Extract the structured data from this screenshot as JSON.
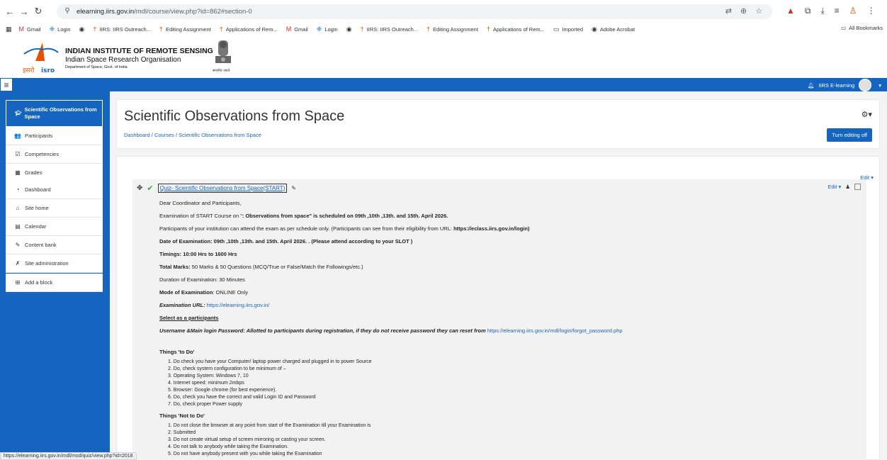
{
  "browser": {
    "url_host": "elearning.iirs.gov.in",
    "url_path": "/mdl/course/view.php?id=862#section-0",
    "bookmarks": [
      {
        "label": "Gmail",
        "icon": "gmail-icon",
        "glyph": "M",
        "color": "#d93025"
      },
      {
        "label": "Login",
        "icon": "login-icon",
        "glyph": "❈",
        "color": "#1565c0"
      },
      {
        "label": "",
        "icon": "globe-icon",
        "glyph": "◉",
        "color": "#333"
      },
      {
        "label": "IIRS: IIRS Outreach...",
        "icon": "iirs-icon",
        "glyph": "†",
        "color": "#e65100"
      },
      {
        "label": "Editing Assignment",
        "icon": "iirs-icon",
        "glyph": "†",
        "color": "#e65100"
      },
      {
        "label": "Applications of Rem...",
        "icon": "iirs-icon",
        "glyph": "†",
        "color": "#e65100"
      },
      {
        "label": "Gmail",
        "icon": "gmail-icon",
        "glyph": "M",
        "color": "#d93025"
      },
      {
        "label": "Login",
        "icon": "login-icon",
        "glyph": "❈",
        "color": "#1565c0"
      },
      {
        "label": "",
        "icon": "globe-icon",
        "glyph": "◉",
        "color": "#333"
      },
      {
        "label": "IIRS: IIRS Outreach...",
        "icon": "iirs-icon",
        "glyph": "†",
        "color": "#e65100"
      },
      {
        "label": "Editing Assignment",
        "icon": "iirs-icon",
        "glyph": "†",
        "color": "#e65100"
      },
      {
        "label": "Applications of Rem...",
        "icon": "iirs-icon",
        "glyph": "†",
        "color": "#e65100"
      },
      {
        "label": "Imported",
        "icon": "folder-icon",
        "glyph": "▭",
        "color": "#333"
      },
      {
        "label": "Adobe Acrobat",
        "icon": "globe-icon",
        "glyph": "◉",
        "color": "#333"
      }
    ],
    "all_bookmarks": "All Bookmarks",
    "status_url": "https://elearning.iirs.gov.in/mdl/mod/quiz/view.php?id=2018"
  },
  "header": {
    "inst_en": "INDIAN INSTITUTE OF REMOTE SENSING",
    "org": "Indian Space Research Organisation",
    "dept": "Department of Space, Govt. of India",
    "logo_text": "इसरो isro",
    "emblem_text": "सत्यमेव जयते"
  },
  "navbar": {
    "site_name": "IIRS E-learning",
    "accent": "#1565c0"
  },
  "drawer": {
    "course": "Scientific Observations from Space",
    "items1": [
      {
        "label": "Participants",
        "icon": "users-icon",
        "glyph": "👥"
      },
      {
        "label": "Competencies",
        "icon": "check-square-icon",
        "glyph": "☑"
      },
      {
        "label": "Grades",
        "icon": "table-icon",
        "glyph": "▦"
      }
    ],
    "items2": [
      {
        "label": "Dashboard",
        "icon": "dashboard-icon",
        "glyph": "◔"
      },
      {
        "label": "Site home",
        "icon": "home-icon",
        "glyph": "⌂"
      },
      {
        "label": "Calendar",
        "icon": "calendar-icon",
        "glyph": "▤"
      },
      {
        "label": "Content bank",
        "icon": "paint-brush-icon",
        "glyph": "✎"
      }
    ],
    "items3": [
      {
        "label": "Site administration",
        "icon": "wrench-icon",
        "glyph": "✗"
      }
    ],
    "items4": [
      {
        "label": "Add a block",
        "icon": "plus-square-icon",
        "glyph": "⊞"
      }
    ]
  },
  "page": {
    "title": "Scientific Observations from Space",
    "breadcrumb": [
      "Dashboard",
      "Courses",
      "Scientific Observations from Space"
    ],
    "turn_editing": "Turn editing off",
    "edit_label": "Edit ▾"
  },
  "activity": {
    "quiz_title": "Quiz- Scientific Observations from Space(START)"
  },
  "content": {
    "greeting": "Dear Coordinator and Participants,",
    "exam_line_a": "Examination of  START Course on \"",
    "exam_line_b": ": Observations from space\" is scheduled on  09",
    "exam_line_dates": "th ,10th ,13th. and 15th. April 2026.",
    "participants_line_a": "Participants of your institution can attend the exam as per schedule only. (Participants can see from their eligibility from URL:  ",
    "participants_url": "https://eclass.iirs.gov.in/login)",
    "date_line": "Date of Examination:  09th ,10th ,13th. and 15th. April 2026. . (Please attend according to your SLOT )",
    "timings": "Timings:  10:00 Hrs to 1600 Hrs",
    "total_marks_label": "Total Marks:",
    "total_marks_value": " 50 Marks & 50 Questions (MCQ/True or False/Match the Followings/etc.)",
    "duration": "Duration of Examination: 30 Minutes",
    "mode_label": "Mode of Examination",
    "mode_value": ": ONLINE Only",
    "exam_url_label": "Examination URL: ",
    "exam_url": "https://elearning.iirs.gov.in/",
    "select_participants": "Select as a participants",
    "username_line": "Username &Main login Password:  Allotted to participants during registration, if they do not receive password they can reset from ",
    "reset_url": "https://elearning.iirs.gov.in/mdl/login/forgot_password.php",
    "todo_title": "Things 'to Do'",
    "todo": [
      "1. Do check you have your Computer/ laptop power charged and plugged in to power Source",
      "2. Do, check system configuration to be minimum of –",
      "3. Operating System: Windows 7, 10",
      "4. Internet speed: minimum 2mbps",
      "5. Browser: Google chrome (for best experience).",
      "6. Do, check you have the correct and valid Login ID and Password",
      "7. Do, check proper Power supply"
    ],
    "nottodo_title": "Things 'Not to Do'",
    "nottodo": [
      "1. Do not close the browser at any point from start of the Examination till your Examination is",
      "2. Submitted",
      "3. Do not create virtual setup of screen mirroring or casting your screen.",
      "4. Do not talk to anybody while taking the Examination.",
      "5. Do not have anybody present with you while taking the Examination"
    ]
  }
}
